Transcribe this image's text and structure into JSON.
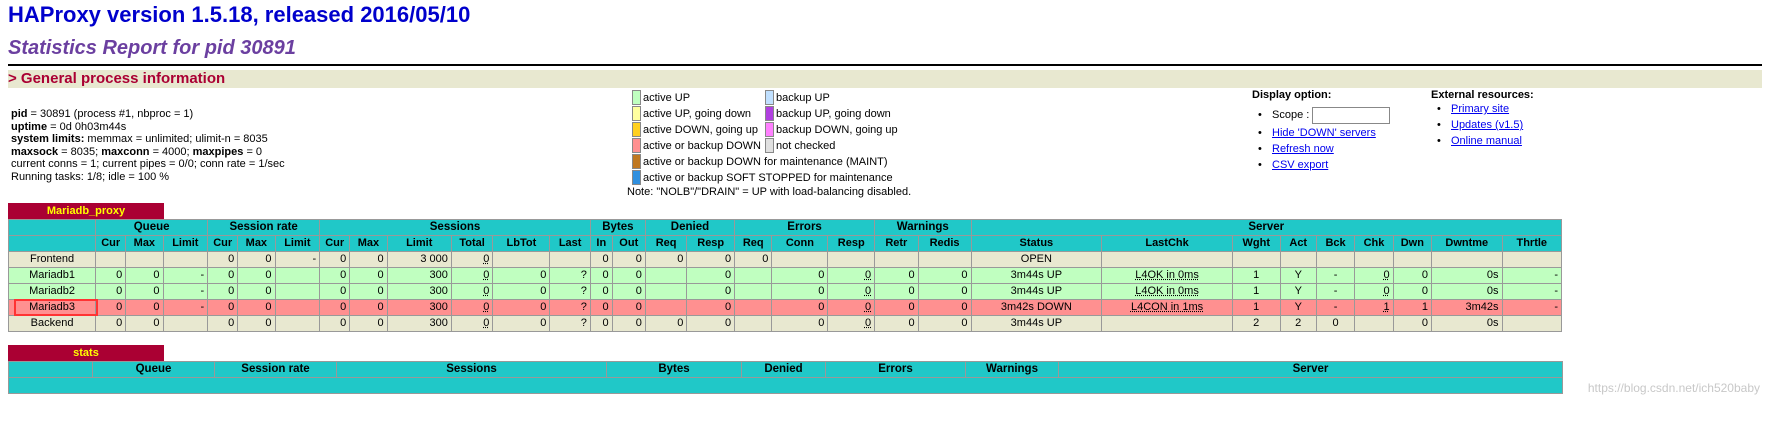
{
  "header": {
    "title": "HAProxy version 1.5.18, released 2016/05/10",
    "subtitle": "Statistics Report for pid 30891",
    "section": "> General process information"
  },
  "process": {
    "pid_label": "pid",
    "pid_value": " = 30891 (process #1, nbproc = 1)",
    "uptime_label": "uptime",
    "uptime_value": " = 0d 0h03m44s",
    "limits_label": "system limits:",
    "limits_value": " memmax = unlimited; ulimit-n = 8035",
    "maxsock_label": "maxsock",
    "maxsock_value": " = 8035; ",
    "maxconn_label": "maxconn",
    "maxconn_value": " = 4000; ",
    "maxpipes_label": "maxpipes",
    "maxpipes_value": " = 0",
    "conns_line": "current conns = 1; current pipes = 0/0; conn rate = 1/sec",
    "tasks_line": "Running tasks: 1/8; idle = 100 %"
  },
  "legend": {
    "left": [
      {
        "label": "active UP",
        "color": "#c0ffc0"
      },
      {
        "label": "active UP, going down",
        "color": "#ffffa0"
      },
      {
        "label": "active DOWN, going up",
        "color": "#ffd020"
      },
      {
        "label": "active or backup DOWN",
        "color": "#ff9090"
      },
      {
        "label": "active or backup DOWN for maintenance (MAINT)",
        "color": "#c07820"
      },
      {
        "label": "active or backup SOFT STOPPED for maintenance",
        "color": "#3090e0"
      }
    ],
    "right": [
      {
        "label": "backup UP",
        "color": "#c0e0ff"
      },
      {
        "label": "backup UP, going down",
        "color": "#b040e0"
      },
      {
        "label": "backup DOWN, going up",
        "color": "#ff80ff"
      },
      {
        "label": "not checked",
        "color": "#e0e0e0"
      }
    ],
    "note": "Note: \"NOLB\"/\"DRAIN\" = UP with load-balancing disabled."
  },
  "display": {
    "title": "Display option:",
    "scope_label": "Scope :",
    "scope_value": "",
    "hide_down": "Hide 'DOWN' servers",
    "refresh": "Refresh now",
    "csv": "CSV export"
  },
  "external": {
    "title": "External resources:",
    "primary": "Primary site",
    "updates": "Updates (v1.5)",
    "manual": "Online manual"
  },
  "proxy1": {
    "name": "Mariadb_proxy",
    "groups": [
      "",
      "Queue",
      "Session rate",
      "Sessions",
      "Bytes",
      "Denied",
      "Errors",
      "Warnings",
      "Server"
    ],
    "columns": [
      "",
      "Cur",
      "Max",
      "Limit",
      "Cur",
      "Max",
      "Limit",
      "Cur",
      "Max",
      "Limit",
      "Total",
      "LbTot",
      "Last",
      "In",
      "Out",
      "Req",
      "Resp",
      "Req",
      "Conn",
      "Resp",
      "Retr",
      "Redis",
      "Status",
      "LastChk",
      "Wght",
      "Act",
      "Bck",
      "Chk",
      "Dwn",
      "Dwntme",
      "Thrtle"
    ],
    "rows": [
      {
        "type": "frontend",
        "cells": [
          "Frontend",
          "",
          "",
          "",
          "0",
          "0",
          "-",
          "0",
          "0",
          "3 000",
          "0",
          "",
          "",
          "0",
          "0",
          "0",
          "0",
          "0",
          "",
          "",
          "",
          "",
          "OPEN",
          "",
          "",
          "",
          "",
          "",
          "",
          "",
          ""
        ]
      },
      {
        "type": "up",
        "cells": [
          "Mariadb1",
          "0",
          "0",
          "-",
          "0",
          "0",
          "",
          "0",
          "0",
          "300",
          "0",
          "0",
          "?",
          "0",
          "0",
          "",
          "0",
          "",
          "0",
          "0",
          "0",
          "0",
          "3m44s UP",
          "L4OK in 0ms",
          "1",
          "Y",
          "-",
          "0",
          "0",
          "0s",
          "-"
        ]
      },
      {
        "type": "up",
        "cells": [
          "Mariadb2",
          "0",
          "0",
          "-",
          "0",
          "0",
          "",
          "0",
          "0",
          "300",
          "0",
          "0",
          "?",
          "0",
          "0",
          "",
          "0",
          "",
          "0",
          "0",
          "0",
          "0",
          "3m44s UP",
          "L4OK in 0ms",
          "1",
          "Y",
          "-",
          "0",
          "0",
          "0s",
          "-"
        ]
      },
      {
        "type": "down",
        "cells": [
          "Mariadb3",
          "0",
          "0",
          "-",
          "0",
          "0",
          "",
          "0",
          "0",
          "300",
          "0",
          "0",
          "?",
          "0",
          "0",
          "",
          "0",
          "",
          "0",
          "0",
          "0",
          "0",
          "3m42s DOWN",
          "L4CON in 1ms",
          "1",
          "Y",
          "-",
          "1",
          "1",
          "3m42s",
          "-"
        ]
      },
      {
        "type": "backend",
        "cells": [
          "Backend",
          "0",
          "0",
          "",
          "0",
          "0",
          "",
          "0",
          "0",
          "300",
          "0",
          "0",
          "?",
          "0",
          "0",
          "0",
          "0",
          "",
          "0",
          "0",
          "0",
          "0",
          "3m44s UP",
          "",
          "2",
          "2",
          "0",
          "",
          "0",
          "0s",
          ""
        ]
      }
    ]
  },
  "proxy2": {
    "name": "stats",
    "groups": [
      "",
      "Queue",
      "Session rate",
      "Sessions",
      "Bytes",
      "Denied",
      "Errors",
      "Warnings",
      "Server"
    ]
  },
  "watermark": "https://blog.csdn.net/ich520baby"
}
